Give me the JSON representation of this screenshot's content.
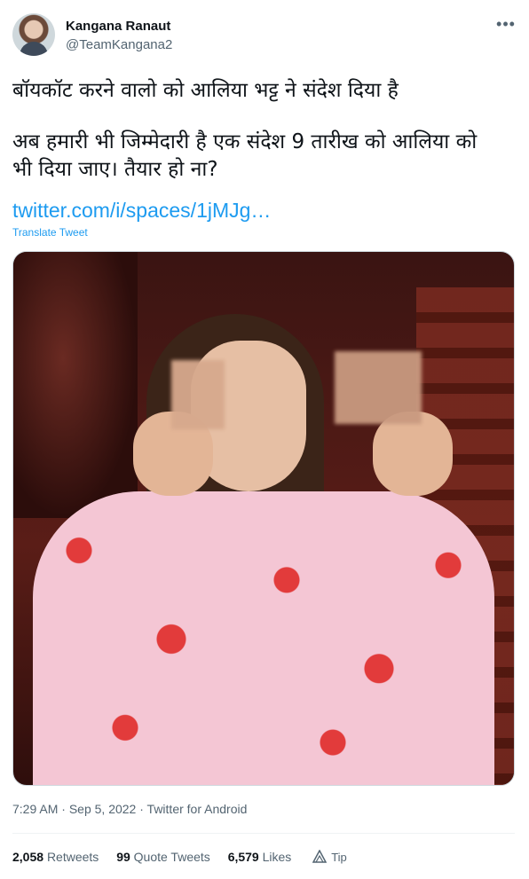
{
  "author": {
    "display_name": "Kangana Ranaut",
    "handle": "@TeamKangana2"
  },
  "tweet": {
    "line1": "बॉयकॉट करने वालो को आलिया भट्ट ने संदेश दिया है",
    "line2": "अब हमारी भी जिम्मेदारी है एक संदेश 9 तारीख को आलिया को",
    "line3": "भी दिया जाए। तैयार हो ना?",
    "link_text": "twitter.com/i/spaces/1jMJg…",
    "translate_label": "Translate Tweet"
  },
  "meta": {
    "time": "7:29 AM",
    "date": "Sep 5, 2022",
    "separator": " · ",
    "source": "Twitter for Android"
  },
  "stats": {
    "retweets_count": "2,058",
    "retweets_label": "Retweets",
    "quotes_count": "99",
    "quotes_label": "Quote Tweets",
    "likes_count": "6,579",
    "likes_label": "Likes",
    "tip_label": "Tip"
  },
  "icons": {
    "more": "more-dots-icon",
    "tip": "tip-icon"
  },
  "colors": {
    "link": "#1d9bf0",
    "secondary_text": "#536471",
    "primary_text": "#0f1419"
  }
}
